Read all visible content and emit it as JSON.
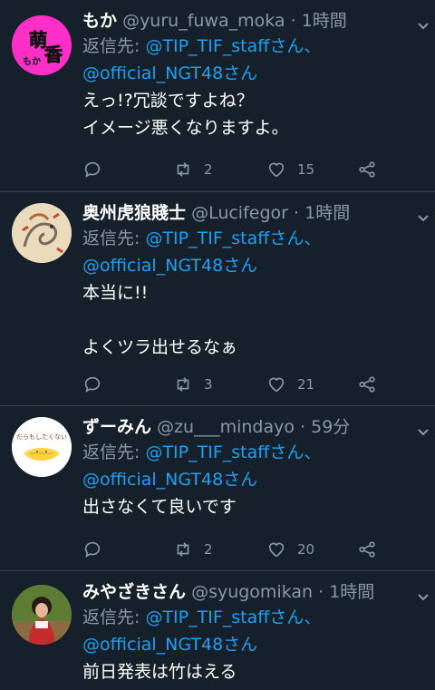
{
  "reply_prefix": "返信先: ",
  "tweets": [
    {
      "name": "もか",
      "handle": "@yuru_fuwa_moka",
      "time": "1時間",
      "reply_to_1": "@TIP_TIF_staffさん、",
      "reply_to_2": "@official_NGT48さん",
      "text": "えっ!?冗談ですよね？\nイメージ悪くなりますよ。",
      "retweets": "2",
      "likes": "15",
      "avatar": "moka-avatar"
    },
    {
      "name": "奥州虎狼賤士",
      "handle": "@Lucifegor",
      "time": "1時間",
      "reply_to_1": "@TIP_TIF_staffさん、",
      "reply_to_2": "@official_NGT48さん",
      "text": "本当に!!\n\nよくツラ出せるなぁ",
      "retweets": "3",
      "likes": "21",
      "avatar": "dragon-avatar"
    },
    {
      "name": "ずーみん",
      "handle": "@zu___mindayo",
      "time": "59分",
      "reply_to_1": "@TIP_TIF_staffさん、",
      "reply_to_2": "@official_NGT48さん",
      "text": "出さなくて良いです",
      "retweets": "2",
      "likes": "20",
      "avatar": "egg-avatar"
    },
    {
      "name": "みやざきさん",
      "handle": "@syugomikan",
      "time": "1時間",
      "reply_to_1": "@TIP_TIF_staffさん、",
      "reply_to_2": "@official_NGT48さん",
      "text": "前日発表は竹はえる",
      "avatar": "child-avatar"
    }
  ],
  "avatar_text": {
    "moka_top": "萌",
    "moka_bottom": "香",
    "moka_small": "もか",
    "egg_caption": "だらもしたくない"
  },
  "colors": {
    "background": "#15202b",
    "text": "#ffffff",
    "muted": "#8899a6",
    "link": "#1da1f2",
    "divider": "#38444d"
  }
}
